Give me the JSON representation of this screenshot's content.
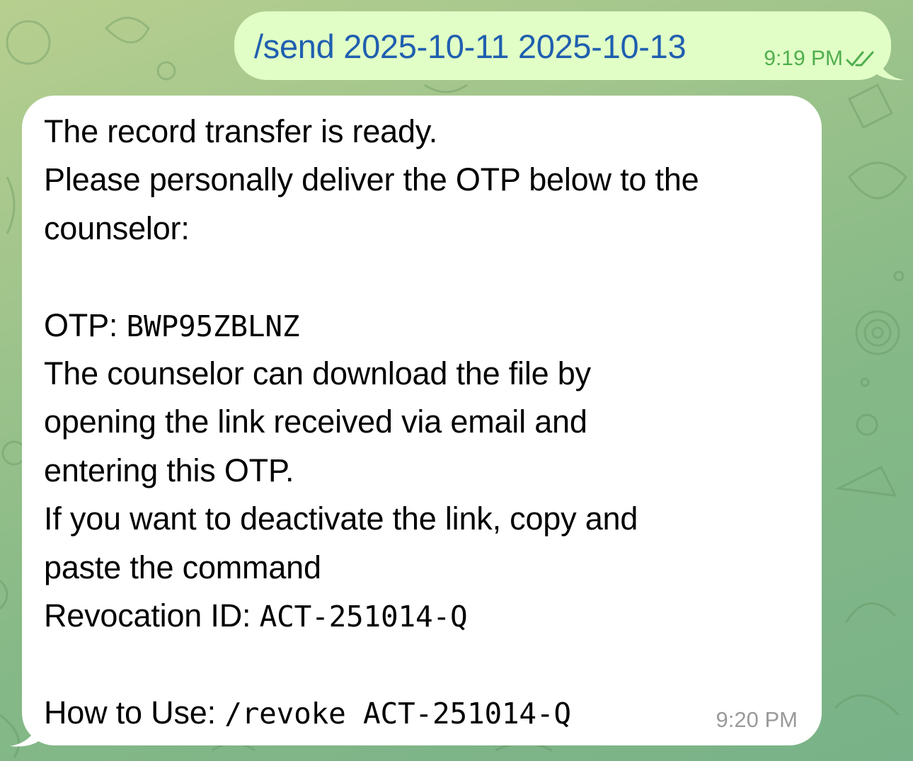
{
  "outgoing": {
    "command": "/send 2025-10-11 2025-10-13",
    "time": "9:19 PM",
    "status_icon": "double-check-icon"
  },
  "incoming": {
    "line1": "The record transfer is ready.",
    "line2": "Please personally deliver the OTP below to the",
    "line3": "counselor:",
    "otp_label": "OTP: ",
    "otp_value": "BWP95ZBLNZ",
    "line5": "The counselor can download the file by",
    "line6": "opening the link received via email and",
    "line7": "entering this OTP.",
    "line8": "If you want to deactivate the link, copy and",
    "line9": "paste the command",
    "revocation_label": "Revocation ID: ",
    "revocation_id": "ACT-251014-Q",
    "howto_label": "How to Use: ",
    "howto_command": "/revoke ACT-251014-Q",
    "time": "9:20 PM"
  },
  "colors": {
    "outgoing_bubble": "#e1fec6",
    "incoming_bubble": "#ffffff",
    "command_text": "#1f5fb0",
    "outgoing_meta": "#4fae4e",
    "incoming_time": "#9a9a9a"
  }
}
